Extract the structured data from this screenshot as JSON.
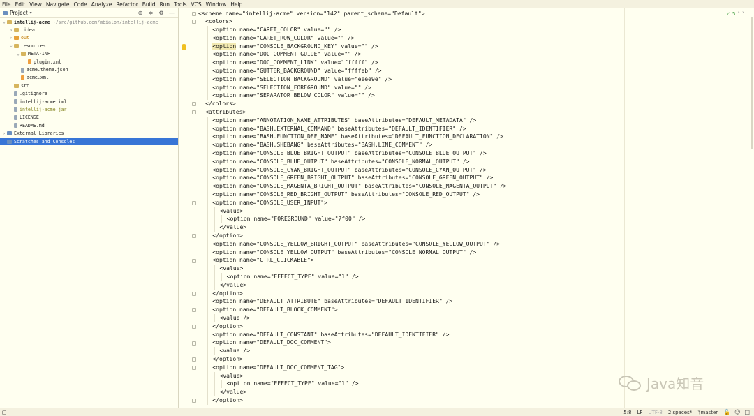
{
  "menu": [
    "File",
    "Edit",
    "View",
    "Navigate",
    "Code",
    "Analyze",
    "Refactor",
    "Build",
    "Run",
    "Tools",
    "VCS",
    "Window",
    "Help"
  ],
  "project_panel": {
    "title": "Project",
    "tree": [
      {
        "label": "intellij-acme",
        "path": "~/src/github.com/mbialon/intellij-acme",
        "indent": 0,
        "arrow": "v",
        "icon": "folder",
        "style": "bold"
      },
      {
        "label": ".idea",
        "indent": 1,
        "arrow": ">",
        "icon": "folder"
      },
      {
        "label": "out",
        "indent": 1,
        "arrow": ">",
        "icon": "folder-out",
        "style": "orange"
      },
      {
        "label": "resources",
        "indent": 1,
        "arrow": "v",
        "icon": "folder"
      },
      {
        "label": "META-INF",
        "indent": 2,
        "arrow": "v",
        "icon": "folder"
      },
      {
        "label": "plugin.xml",
        "indent": 3,
        "arrow": "",
        "icon": "file-xml"
      },
      {
        "label": "acme.theme.json",
        "indent": 2,
        "arrow": "",
        "icon": "file"
      },
      {
        "label": "acme.xml",
        "indent": 2,
        "arrow": "",
        "icon": "file-xml"
      },
      {
        "label": "src",
        "indent": 1,
        "arrow": "",
        "icon": "folder"
      },
      {
        "label": ".gitignore",
        "indent": 1,
        "arrow": "",
        "icon": "file"
      },
      {
        "label": "intellij-acme.iml",
        "indent": 1,
        "arrow": "",
        "icon": "file"
      },
      {
        "label": "intellij-acme.jar",
        "indent": 1,
        "arrow": "",
        "icon": "file",
        "style": "olive"
      },
      {
        "label": "LICENSE",
        "indent": 1,
        "arrow": "",
        "icon": "file"
      },
      {
        "label": "README.md",
        "indent": 1,
        "arrow": "",
        "icon": "file"
      },
      {
        "label": "External Libraries",
        "indent": 0,
        "arrow": ">",
        "icon": "lib"
      },
      {
        "label": "Scratches and Consoles",
        "indent": 0,
        "arrow": "",
        "icon": "lib",
        "selected": true
      }
    ]
  },
  "editor": {
    "inspection_count": "5",
    "lines": [
      {
        "indent": 0,
        "text": "<scheme name=\"intellij-acme\" version=\"142\" parent_scheme=\"Default\">",
        "fold": true
      },
      {
        "indent": 1,
        "text": "<colors>",
        "fold": true
      },
      {
        "indent": 2,
        "text": "<option name=\"CARET_COLOR\" value=\"\" />"
      },
      {
        "indent": 2,
        "text": "<option name=\"CARET_ROW_COLOR\" value=\"\" />"
      },
      {
        "indent": 2,
        "text": "<option name=\"CONSOLE_BACKGROUND_KEY\" value=\"\" />",
        "highlight": "<option",
        "bulb": true
      },
      {
        "indent": 2,
        "text": "<option name=\"DOC_COMMENT_GUIDE\" value=\"\" />"
      },
      {
        "indent": 2,
        "text": "<option name=\"DOC_COMMENT_LINK\" value=\"ffffff\" />"
      },
      {
        "indent": 2,
        "text": "<option name=\"GUTTER_BACKGROUND\" value=\"ffffeb\" />"
      },
      {
        "indent": 2,
        "text": "<option name=\"SELECTION_BACKGROUND\" value=\"eeee9e\" />"
      },
      {
        "indent": 2,
        "text": "<option name=\"SELECTION_FOREGROUND\" value=\"\" />"
      },
      {
        "indent": 2,
        "text": "<option name=\"SEPARATOR_BELOW_COLOR\" value=\"\" />"
      },
      {
        "indent": 1,
        "text": "</colors>",
        "fold": true
      },
      {
        "indent": 1,
        "text": "<attributes>",
        "fold": true
      },
      {
        "indent": 2,
        "text": "<option name=\"ANNOTATION_NAME_ATTRIBUTES\" baseAttributes=\"DEFAULT_METADATA\" />"
      },
      {
        "indent": 2,
        "text": "<option name=\"BASH.EXTERNAL_COMMAND\" baseAttributes=\"DEFAULT_IDENTIFIER\" />"
      },
      {
        "indent": 2,
        "text": "<option name=\"BASH.FUNCTION_DEF_NAME\" baseAttributes=\"DEFAULT_FUNCTION_DECLARATION\" />"
      },
      {
        "indent": 2,
        "text": "<option name=\"BASH.SHEBANG\" baseAttributes=\"BASH.LINE_COMMENT\" />"
      },
      {
        "indent": 2,
        "text": "<option name=\"CONSOLE_BLUE_BRIGHT_OUTPUT\" baseAttributes=\"CONSOLE_BLUE_OUTPUT\" />"
      },
      {
        "indent": 2,
        "text": "<option name=\"CONSOLE_BLUE_OUTPUT\" baseAttributes=\"CONSOLE_NORMAL_OUTPUT\" />"
      },
      {
        "indent": 2,
        "text": "<option name=\"CONSOLE_CYAN_BRIGHT_OUTPUT\" baseAttributes=\"CONSOLE_CYAN_OUTPUT\" />"
      },
      {
        "indent": 2,
        "text": "<option name=\"CONSOLE_GREEN_BRIGHT_OUTPUT\" baseAttributes=\"CONSOLE_GREEN_OUTPUT\" />"
      },
      {
        "indent": 2,
        "text": "<option name=\"CONSOLE_MAGENTA_BRIGHT_OUTPUT\" baseAttributes=\"CONSOLE_MAGENTA_OUTPUT\" />"
      },
      {
        "indent": 2,
        "text": "<option name=\"CONSOLE_RED_BRIGHT_OUTPUT\" baseAttributes=\"CONSOLE_RED_OUTPUT\" />"
      },
      {
        "indent": 2,
        "text": "<option name=\"CONSOLE_USER_INPUT\">",
        "fold": true
      },
      {
        "indent": 3,
        "text": "<value>"
      },
      {
        "indent": 4,
        "text": "<option name=\"FOREGROUND\" value=\"7f00\" />"
      },
      {
        "indent": 3,
        "text": "</value>"
      },
      {
        "indent": 2,
        "text": "</option>",
        "fold": true
      },
      {
        "indent": 2,
        "text": "<option name=\"CONSOLE_YELLOW_BRIGHT_OUTPUT\" baseAttributes=\"CONSOLE_YELLOW_OUTPUT\" />"
      },
      {
        "indent": 2,
        "text": "<option name=\"CONSOLE_YELLOW_OUTPUT\" baseAttributes=\"CONSOLE_NORMAL_OUTPUT\" />"
      },
      {
        "indent": 2,
        "text": "<option name=\"CTRL_CLICKABLE\">",
        "fold": true
      },
      {
        "indent": 3,
        "text": "<value>"
      },
      {
        "indent": 4,
        "text": "<option name=\"EFFECT_TYPE\" value=\"1\" />"
      },
      {
        "indent": 3,
        "text": "</value>"
      },
      {
        "indent": 2,
        "text": "</option>",
        "fold": true
      },
      {
        "indent": 2,
        "text": "<option name=\"DEFAULT_ATTRIBUTE\" baseAttributes=\"DEFAULT_IDENTIFIER\" />"
      },
      {
        "indent": 2,
        "text": "<option name=\"DEFAULT_BLOCK_COMMENT\">",
        "fold": true
      },
      {
        "indent": 3,
        "text": "<value />"
      },
      {
        "indent": 2,
        "text": "</option>",
        "fold": true
      },
      {
        "indent": 2,
        "text": "<option name=\"DEFAULT_CONSTANT\" baseAttributes=\"DEFAULT_IDENTIFIER\" />"
      },
      {
        "indent": 2,
        "text": "<option name=\"DEFAULT_DOC_COMMENT\">",
        "fold": true
      },
      {
        "indent": 3,
        "text": "<value />"
      },
      {
        "indent": 2,
        "text": "</option>",
        "fold": true
      },
      {
        "indent": 2,
        "text": "<option name=\"DEFAULT_DOC_COMMENT_TAG\">",
        "fold": true
      },
      {
        "indent": 3,
        "text": "<value>"
      },
      {
        "indent": 4,
        "text": "<option name=\"EFFECT_TYPE\" value=\"1\" />"
      },
      {
        "indent": 3,
        "text": "</value>"
      },
      {
        "indent": 2,
        "text": "</option>",
        "fold": true
      }
    ]
  },
  "watermark": "Java知音",
  "statusbar": {
    "position": "5:8",
    "line_separator": "LF",
    "encoding": "UTF-8",
    "indent": "2 spaces*",
    "branch": "master"
  },
  "colors": {
    "background": "#fffff0",
    "selection": "#3875d6",
    "bulb": "#f0c020"
  }
}
